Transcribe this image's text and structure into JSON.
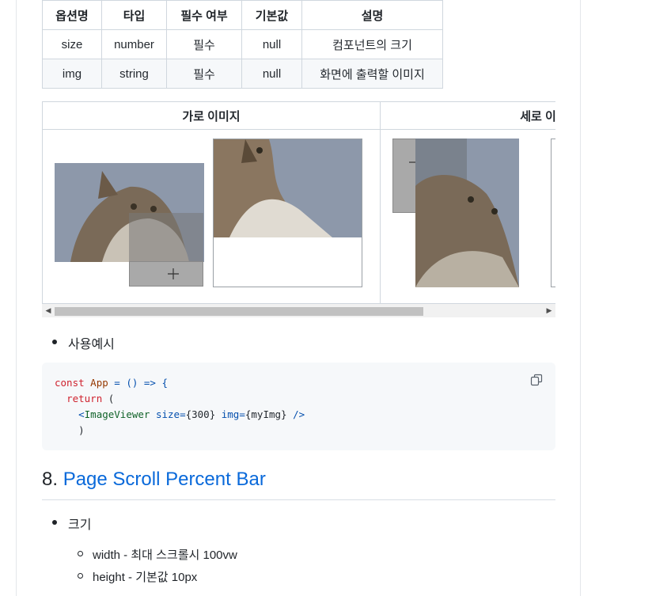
{
  "option_table": {
    "headers": [
      "옵션명",
      "타입",
      "필수 여부",
      "기본값",
      "설명"
    ],
    "rows": [
      [
        "size",
        "number",
        "필수",
        "null",
        "컴포넌트의 크기"
      ],
      [
        "img",
        "string",
        "필수",
        "null",
        "화면에 출력할 이미지"
      ]
    ]
  },
  "image_table": {
    "horizontal_header": "가로 이미지",
    "vertical_header": "세로 이"
  },
  "bullet_usage": "사용예시",
  "code": {
    "line1_kw": "const",
    "line1_fn": "App",
    "line1_rest": " = () => {",
    "line2_kw": "return",
    "line2_rest": " (",
    "line3_open": "<",
    "line3_tag": "ImageViewer",
    "line3_attr1": " size=",
    "line3_val1": "{300}",
    "line3_attr2": " img=",
    "line3_val2": "{myImg}",
    "line3_close": " />",
    "line4": ")"
  },
  "section": {
    "number": "8.",
    "title": "Page Scroll Percent Bar"
  },
  "bullet_size": "크기",
  "sub_bullets": [
    "width - 최대 스크롤시 100vw",
    "height - 기본값 10px"
  ],
  "icons": {
    "plus": "plus-icon",
    "minus": "minus-icon",
    "copy": "copy-icon"
  },
  "colors": {
    "link": "#0969da",
    "keyword": "#cf222e",
    "code_bg": "#f6f8fa"
  }
}
